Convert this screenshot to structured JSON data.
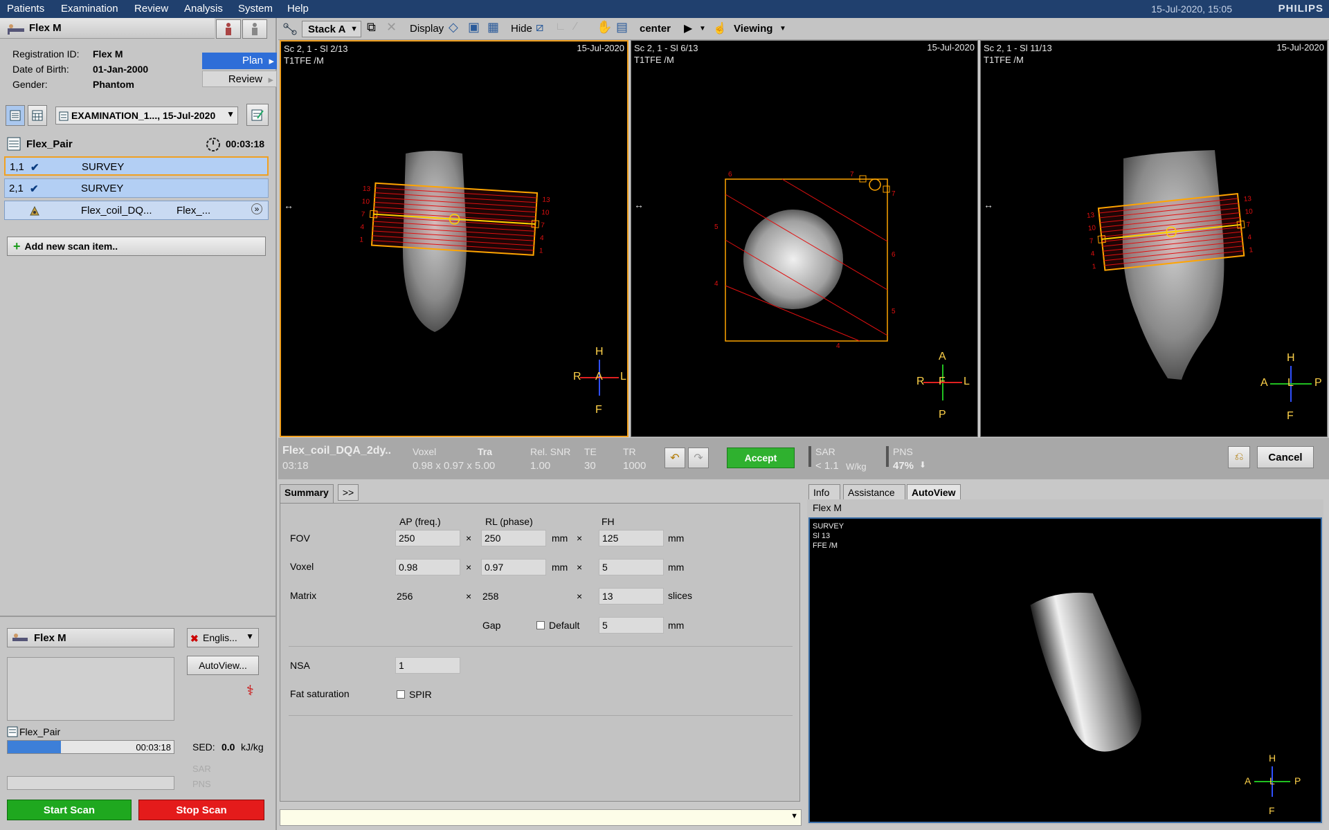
{
  "menu": {
    "items": [
      "Patients",
      "Examination",
      "Review",
      "Analysis",
      "System",
      "Help"
    ],
    "datetime": "15-Jul-2020, 15:05",
    "brand": "PHILIPS"
  },
  "patient": {
    "name": "Flex M",
    "reg_label": "Registration ID:",
    "reg_value": "Flex M",
    "dob_label": "Date of Birth:",
    "dob_value": "01-Jan-2000",
    "gender_label": "Gender:",
    "gender_value": "Phantom"
  },
  "mode_menu": {
    "plan": "Plan",
    "review": "Review"
  },
  "exam": {
    "select": "EXAMINATION_1..., 15-Jul-2020"
  },
  "protocol": {
    "name": "Flex_Pair",
    "time": "00:03:18"
  },
  "scans": [
    {
      "id": "1,1",
      "name": "SURVEY"
    },
    {
      "id": "2,1",
      "name": "SURVEY"
    },
    {
      "name": "Flex_coil_DQ...",
      "coil": "Flex_..."
    }
  ],
  "add_scan": "Add new scan item..",
  "bottom": {
    "patient": "Flex M",
    "language": "Englis...",
    "autoview": "AutoView...",
    "protocol": "Flex_Pair",
    "progress_time": "00:03:18",
    "progress": 0.32,
    "sed_label": "SED:",
    "sed_value": "0.0",
    "sed_unit": "kJ/kg",
    "sar": "SAR",
    "pns": "PNS",
    "start": "Start Scan",
    "stop": "Stop Scan"
  },
  "toolbar": {
    "stack": "Stack A",
    "display": "Display",
    "hide": "Hide",
    "center": "center",
    "viewing": "Viewing"
  },
  "viewports": [
    {
      "title": "Sc 2, 1 - Sl 2/13",
      "seq": "T1TFE  /M",
      "date": "15-Jul-2020",
      "o_top": "H",
      "o_left": "R",
      "o_center": "A",
      "o_right": "L",
      "o_bottom": "F"
    },
    {
      "title": "Sc 2, 1 - Sl 6/13",
      "seq": "T1TFE  /M",
      "date": "15-Jul-2020",
      "o_top": "A",
      "o_left": "R",
      "o_center": "F",
      "o_right": "L",
      "o_bottom": "P"
    },
    {
      "title": "Sc 2, 1 - Sl 11/13",
      "seq": "T1TFE  /M",
      "date": "15-Jul-2020",
      "o_top": "H",
      "o_left": "A",
      "o_center": "L",
      "o_right": "P",
      "o_bottom": "F"
    }
  ],
  "scaninfo": {
    "name": "Flex_coil_DQA_2dy..",
    "time": "03:18",
    "voxel_label": "Voxel",
    "voxel_value": "0.98 x 0.97 x 5.00",
    "orient": "Tra",
    "snr_label": "Rel. SNR",
    "snr_value": "1.00",
    "te_label": "TE",
    "te_value": "30",
    "tr_label": "TR",
    "tr_value": "1000",
    "accept": "Accept",
    "sar_label": "SAR",
    "sar_value": "< 1.1",
    "sar_unit": "W/kg",
    "pns_label": "PNS",
    "pns_value": "47%",
    "cancel": "Cancel"
  },
  "summary": {
    "tab": "Summary",
    "more": ">>",
    "col_ap": "AP (freq.)",
    "col_rl": "RL (phase)",
    "col_fh": "FH",
    "fov_label": "FOV",
    "fov_ap": "250",
    "fov_rl": "250",
    "fov_fh": "125",
    "voxel_label": "Voxel",
    "voxel_ap": "0.98",
    "voxel_rl": "0.97",
    "voxel_fh": "5",
    "matrix_label": "Matrix",
    "matrix_ap": "256",
    "matrix_rl": "258",
    "matrix_fh": "13",
    "gap_label": "Gap",
    "default_label": "Default",
    "gap_value": "5",
    "mm": "mm",
    "x": "×",
    "slices": "slices",
    "nsa_label": "NSA",
    "nsa_value": "1",
    "fat_label": "Fat saturation",
    "spir": "SPIR"
  },
  "rightpanel": {
    "tab_info": "Info",
    "tab_assist": "Assistance",
    "tab_autoview": "AutoView",
    "patient": "Flex M",
    "img_line1": "SURVEY",
    "img_line2": "Sl 13",
    "img_line3": "FFE  /M",
    "o_top": "H",
    "o_left": "A",
    "o_center": "L",
    "o_right": "P",
    "o_bottom": "F"
  },
  "colors": {
    "menubar": "#20406e",
    "selection": "#b3cff4",
    "accept": "#2fb12f",
    "start": "#1fa81f",
    "stop": "#e41b1b",
    "planning": "#ffa500",
    "slices": "#e01010"
  }
}
